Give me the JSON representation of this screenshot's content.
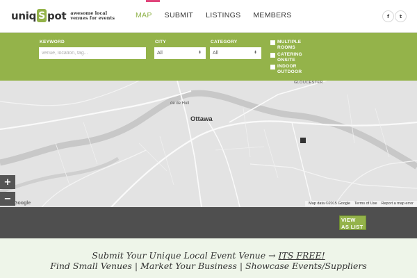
{
  "header": {
    "logo_prefix": "uniq",
    "logo_s": "S",
    "logo_suffix": "pot",
    "tagline": "awesome local venues for events",
    "nav": [
      "MAP",
      "SUBMIT",
      "LISTINGS",
      "MEMBERS"
    ],
    "social": {
      "facebook": "f",
      "twitter": "t"
    },
    "colors": {
      "brand": "#94b34a",
      "accent": "#e0457b"
    }
  },
  "search": {
    "keyword_label": "KEYWORD",
    "keyword_placeholder": "venue, location, tag...",
    "city_label": "CITY",
    "city_value": "All",
    "category_label": "CATEGORY",
    "category_value": "All",
    "checkboxes": [
      "MULTIPLE ROOMS",
      "CATERING ONSITE",
      "INDOOR OUTDOOR"
    ]
  },
  "map": {
    "city": "Ottawa",
    "hull": "de de Hull",
    "gloucester": "GLOUCESTER",
    "zoom_in": "+",
    "zoom_out": "−",
    "google": "Google",
    "attribution": "Map data ©2015 Google",
    "terms": "Terms of Use",
    "report": "Report a map error"
  },
  "bar": {
    "view_list": "VIEW AS LIST"
  },
  "promo": {
    "line1_text": "Submit Your Unique Local Event Venue → ",
    "line1_link": "ITS FREE!",
    "line2": "Find Small Venues | Market Your Business | Showcase Events/Suppliers"
  }
}
